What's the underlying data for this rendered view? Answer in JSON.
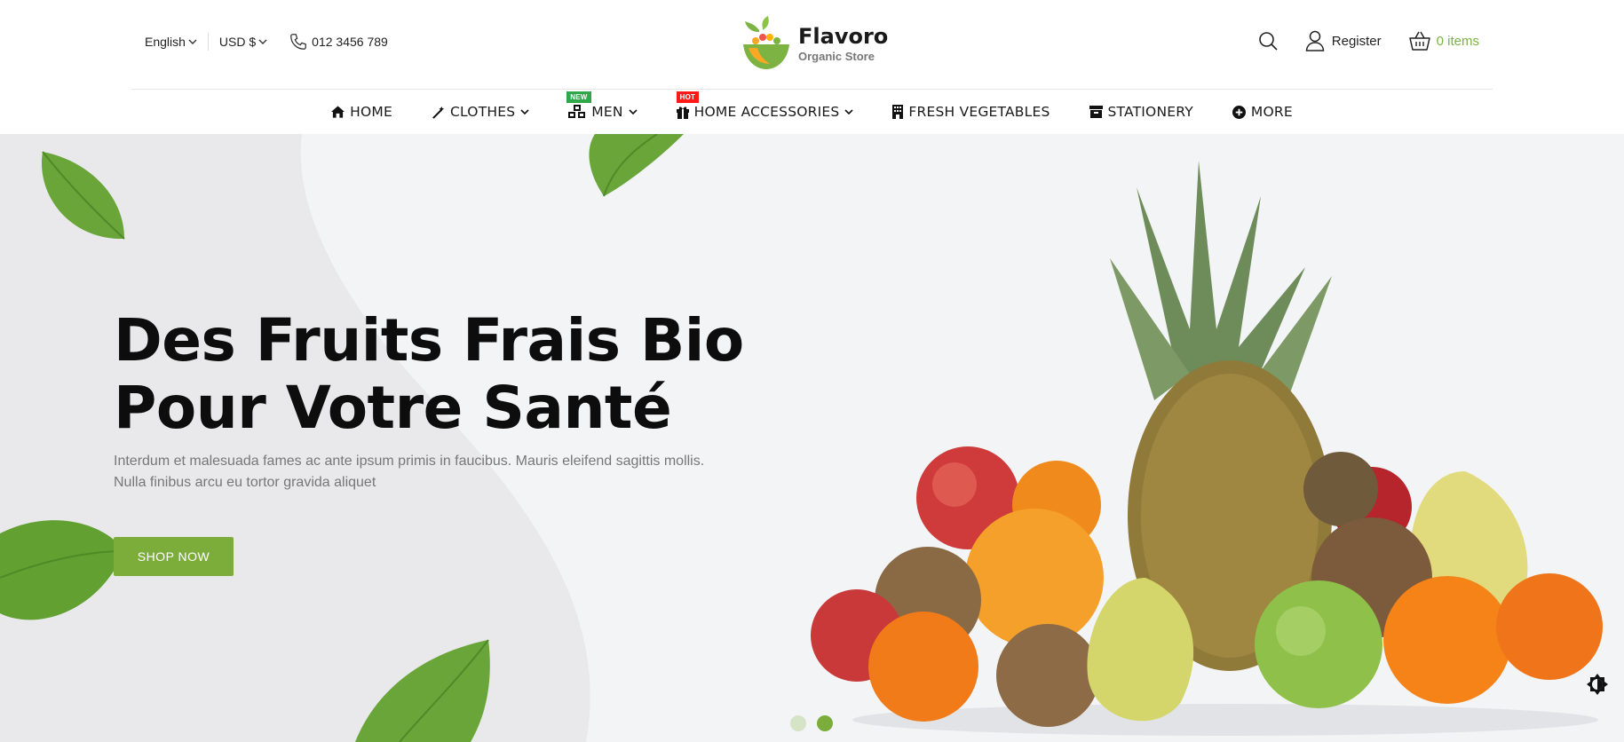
{
  "topbar": {
    "language": "English",
    "currency": "USD $",
    "phone": "012 3456 789",
    "register_label": "Register",
    "cart_label": "0 items"
  },
  "logo": {
    "name": "Flavoro",
    "tagline": "Organic Store"
  },
  "nav": {
    "items": [
      {
        "label": "HOME",
        "icon": "home-icon"
      },
      {
        "label": "CLOTHES",
        "icon": "magic-wand-icon",
        "dropdown": true
      },
      {
        "label": "MEN",
        "icon": "cubes-icon",
        "dropdown": true,
        "badge": "NEW"
      },
      {
        "label": "HOME ACCESSORIES",
        "icon": "gift-icon",
        "dropdown": true,
        "badge": "HOT"
      },
      {
        "label": "FRESH VEGETABLES",
        "icon": "building-icon"
      },
      {
        "label": "STATIONERY",
        "icon": "archive-icon"
      },
      {
        "label": "MORE",
        "icon": "plus-circle-icon"
      }
    ]
  },
  "hero": {
    "title_line1": "Des Fruits Frais Bio",
    "title_line2": "Pour Votre Santé",
    "subtitle_line1": "Interdum et malesuada fames ac ante ipsum primis in faucibus. Mauris eleifend sagittis mollis.",
    "subtitle_line2": "Nulla finibus arcu eu tortor gravida aliquet",
    "button_label": "SHOP NOW",
    "slides_total": 2,
    "active_slide": 2
  },
  "colors": {
    "accent": "#7cad3a",
    "badge_new": "#2ea84b",
    "badge_hot": "#ff1a1a",
    "hero_bg": "#f3f4f6"
  }
}
